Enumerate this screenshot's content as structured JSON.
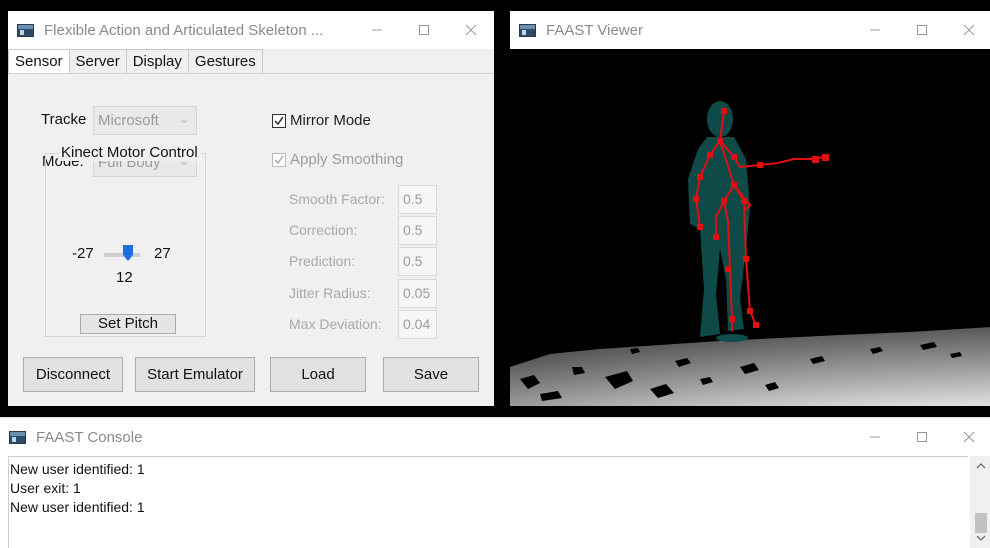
{
  "main_window": {
    "title": "Flexible Action and Articulated Skeleton ...",
    "tabs": [
      "Sensor",
      "Server",
      "Display",
      "Gestures"
    ],
    "active_tab": "Sensor",
    "tracker_label": "Tracke",
    "tracker_value": "Microsoft",
    "mode_label": "Mode:",
    "mode_value": "Full Body",
    "mirror_mode_label": "Mirror Mode",
    "mirror_mode_checked": true,
    "apply_smoothing_label": "Apply Smoothing",
    "apply_smoothing_checked": true,
    "params": [
      {
        "label": "Smooth Factor:",
        "value": "0.5"
      },
      {
        "label": "Correction:",
        "value": "0.5"
      },
      {
        "label": "Prediction:",
        "value": "0.5"
      },
      {
        "label": "Jitter Radius:",
        "value": "0.05"
      },
      {
        "label": "Max Deviation:",
        "value": "0.04"
      }
    ],
    "motor_group_title": "Kinect Motor Control",
    "motor_min": "-27",
    "motor_max": "27",
    "motor_value": "12",
    "set_pitch_label": "Set Pitch",
    "buttons": {
      "disconnect": "Disconnect",
      "start_emulator": "Start Emulator",
      "load": "Load",
      "save": "Save"
    }
  },
  "viewer_window": {
    "title": "FAAST Viewer",
    "skeleton_color": "#e01010",
    "silhouette_color": "#0d4a48"
  },
  "console_window": {
    "title": "FAAST Console",
    "lines": [
      "New user identified: 1",
      "User exit: 1",
      "New user identified: 1"
    ]
  },
  "icons": {
    "app": "app-window-icon",
    "minimize": "minimize-icon",
    "maximize": "maximize-icon",
    "close": "close-icon"
  }
}
